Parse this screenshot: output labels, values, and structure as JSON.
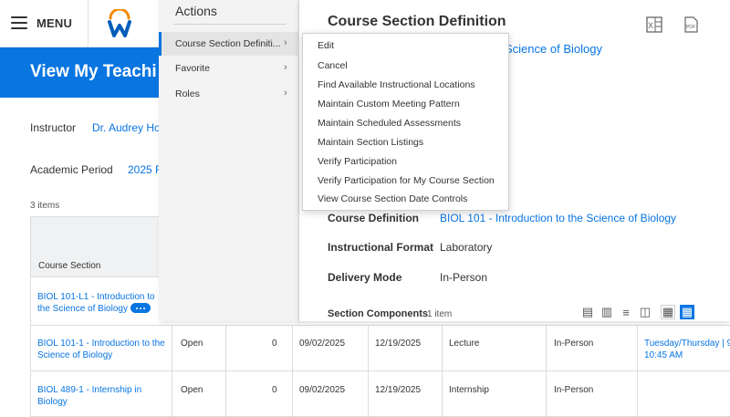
{
  "topbar": {
    "menu_label": "MENU"
  },
  "page": {
    "title": "View My Teachi",
    "instructor_label": "Instructor",
    "instructor_value": "Dr. Audrey Ho",
    "period_label": "Academic Period",
    "period_value": "2025 F",
    "items_count": "3 items"
  },
  "table": {
    "col_course": "Course Section",
    "rows": [
      {
        "course_line1": "BIOL 101-L1 - Introduction to",
        "course_line2": "the Science of Biology"
      },
      {
        "course_line1": "BIOL 101-1 - Introduction to the",
        "course_line2": "Science of Biology",
        "status": "Open",
        "count": "0",
        "start": "09/02/2025",
        "end": "12/19/2025",
        "format": "Lecture",
        "mode": "In-Person",
        "meeting_line1": "Tuesday/Thursday | 9",
        "meeting_line2": "10:45 AM"
      },
      {
        "course_line1": "BIOL 489-1 - Internship in",
        "course_line2": "Biology",
        "status": "Open",
        "count": "0",
        "start": "09/02/2025",
        "end": "12/19/2025",
        "format": "Internship",
        "mode": "In-Person"
      }
    ]
  },
  "actions": {
    "title": "Actions",
    "items": [
      {
        "label": "Course Section Definiti..."
      },
      {
        "label": "Favorite"
      },
      {
        "label": "Roles"
      }
    ]
  },
  "submenu": {
    "items": [
      "Edit",
      "Cancel",
      "Find Available Instructional Locations",
      "Maintain Custom Meeting Pattern",
      "Maintain Scheduled Assessments",
      "Maintain Section Listings",
      "Verify Participation",
      "Verify Participation for My Course Section",
      "View Course Section Date Controls"
    ]
  },
  "detail": {
    "title": "Course Section Definition",
    "subtitle": "Science of Biology",
    "course_def_label": "Course Definition",
    "course_def_value": "BIOL 101 - Introduction to the Science of Biology",
    "format_label": "Instructional Format",
    "format_value": "Laboratory",
    "delivery_label": "Delivery Mode",
    "delivery_value": "In-Person",
    "components_label": "Section Components",
    "components_count": "1 item",
    "excel_icon_text": "X",
    "pdf_icon_text": "PDF"
  },
  "colors": {
    "accent": "#0875e1",
    "logo_orange": "#f38b00"
  }
}
